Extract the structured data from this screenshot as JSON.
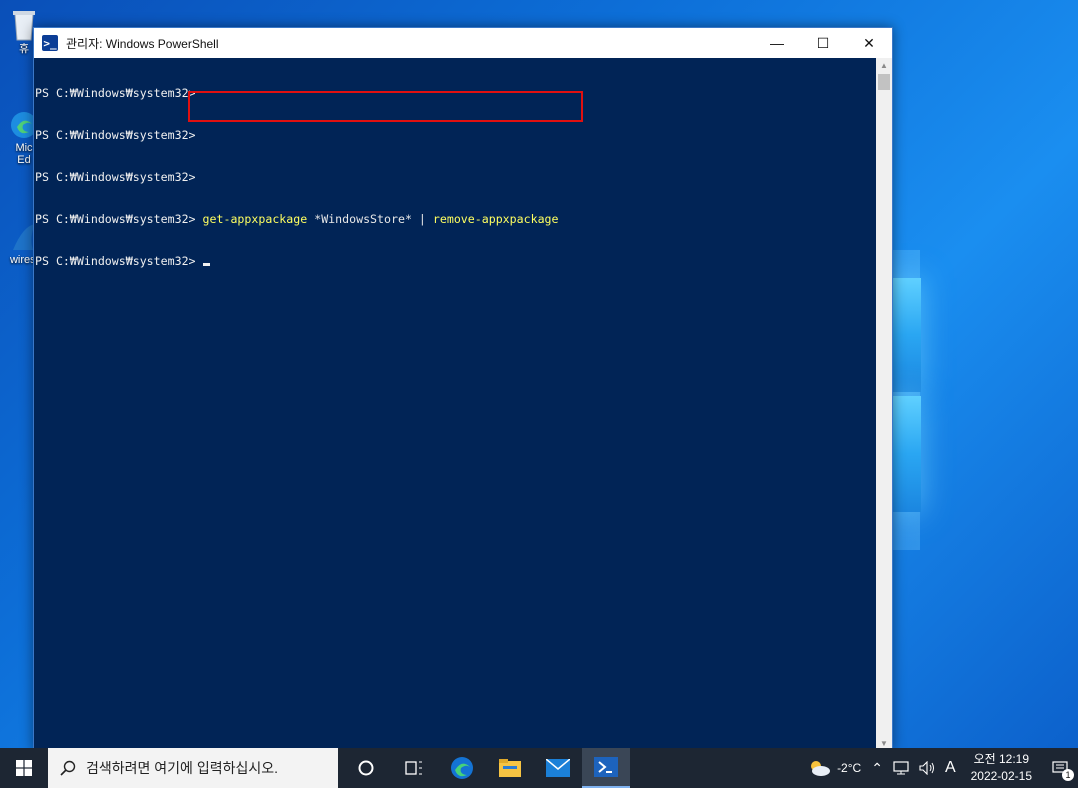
{
  "desktop": {
    "icons": [
      {
        "label": "휴"
      },
      {
        "label": "Mic\nEd"
      },
      {
        "label": "wiresl"
      }
    ]
  },
  "window": {
    "title": "관리자: Windows PowerShell",
    "app_icon_glyph": ">_",
    "minimize_label": "—",
    "maximize_label": "☐",
    "close_label": "✕"
  },
  "console": {
    "prompt": "PS C:\\Windows\\system32>",
    "lines": [
      {
        "prompt": "PS C:₩Windows₩system32>",
        "cmd_yellow": "",
        "cmd_gray": "",
        "cmd_yellow2": ""
      },
      {
        "prompt": "PS C:₩Windows₩system32>",
        "cmd_yellow": "",
        "cmd_gray": "",
        "cmd_yellow2": ""
      },
      {
        "prompt": "PS C:₩Windows₩system32>",
        "cmd_yellow": "",
        "cmd_gray": "",
        "cmd_yellow2": ""
      },
      {
        "prompt": "PS C:₩Windows₩system32>",
        "cmd_yellow": " get-appxpackage",
        "cmd_gray": " *WindowsStore* | ",
        "cmd_yellow2": "remove-appxpackage"
      },
      {
        "prompt": "PS C:₩Windows₩system32>",
        "cmd_yellow": "",
        "cmd_gray": "",
        "cmd_yellow2": ""
      }
    ],
    "background": "#012456",
    "highlight_color": "#e01010"
  },
  "taskbar": {
    "search_placeholder": "검색하려면 여기에 입력하십시오.",
    "pinned": [
      "cortana-icon",
      "task-view-icon",
      "edge-icon",
      "file-explorer-icon",
      "mail-icon",
      "powershell-icon"
    ],
    "active": "powershell-icon",
    "weather": "-2°C",
    "ime": "A",
    "time": "오전 12:19",
    "date": "2022-02-15",
    "notification_count": "1"
  }
}
